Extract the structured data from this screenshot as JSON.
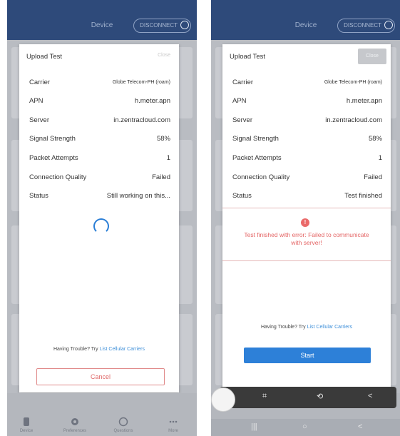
{
  "top_bar": {
    "title": "Device",
    "disconnect_label": "DISCONNECT"
  },
  "modal": {
    "title": "Upload Test",
    "close_label": "Close",
    "fields": [
      {
        "label": "Carrier",
        "value": "Globe Telecom-PH (roam)"
      },
      {
        "label": "APN",
        "value": "h.meter.apn"
      },
      {
        "label": "Server",
        "value": "in.zentracloud.com"
      },
      {
        "label": "Signal Strength",
        "value": "58%"
      },
      {
        "label": "Packet Attempts",
        "value": "1"
      },
      {
        "label": "Connection Quality",
        "value": "Failed"
      }
    ],
    "status_label": "Status",
    "status_in_progress": "Still working on this...",
    "status_done": "Test finished",
    "error_icon": "!",
    "error_message": "Test finished with error: Failed to communicate with server!",
    "trouble_text": "Having Trouble? Try",
    "trouble_link": "List Cellular Carriers",
    "cancel_label": "Cancel",
    "start_label": "Start"
  },
  "bottom_nav": [
    "Device",
    "Preferences",
    "Questions",
    "More"
  ],
  "share_toolbar": {
    "icons": [
      "crop-icon",
      "rotate-icon",
      "share-icon"
    ]
  },
  "icons": {
    "spinner": "loading-spinner-icon",
    "error": "error-circle-icon"
  },
  "colors": {
    "header": "#2e4a7a",
    "primary_blue": "#2d80d8",
    "error_red": "#e46565"
  }
}
